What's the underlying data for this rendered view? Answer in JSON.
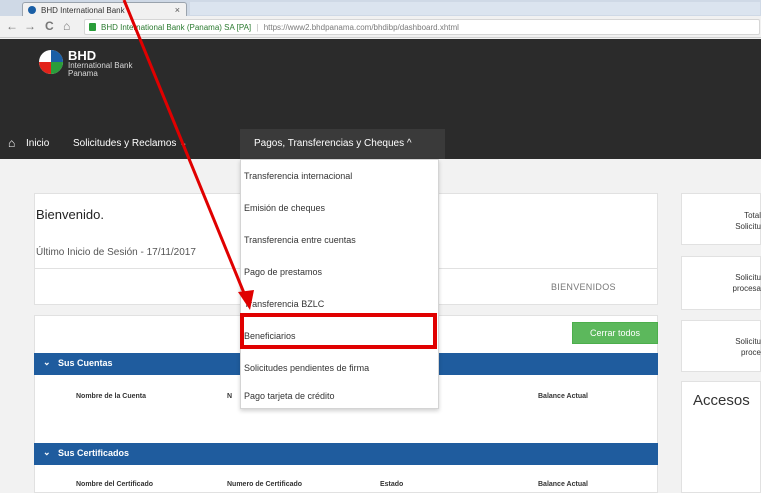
{
  "browser": {
    "tab_title": "BHD International Bank",
    "tab_close": "×",
    "url_secure_text": "BHD International Bank (Panama) SA [PA]",
    "url": "https://www2.bhdpanama.com/bhdibp/dashboard.xhtml",
    "back_glyph": "←",
    "forward_glyph": "→",
    "reload_glyph": "C",
    "home_glyph": "⌂"
  },
  "brand": {
    "name": "BHD",
    "line1": "International Bank",
    "line2": "Panama"
  },
  "nav": {
    "home_glyph": "⌂",
    "home_label": "Inicio",
    "requests_label": "Solicitudes y Reclamos",
    "requests_caret": "⌄",
    "payments_label": "Pagos, Transferencias y Cheques",
    "payments_caret": "^"
  },
  "dropdown": {
    "items": [
      "Transferencia internacional",
      "Emisión de cheques",
      "Transferencia entre cuentas",
      "Pago de prestamos",
      "Transferencia BZLC",
      "Beneficiarios",
      "Solicitudes pendientes de firma",
      "Pago tarjeta de crédito"
    ],
    "highlighted_index": 5
  },
  "welcome": {
    "title": "Bienvenido.",
    "last_login": "Último Inicio de Sesión - 17/11/2017",
    "banner": "BIENVENIDOS"
  },
  "actions": {
    "close_all": "Cerrar todos"
  },
  "accounts_panel": {
    "title": "Sus Cuentas",
    "chevron": "⌄",
    "columns": [
      "Nombre de la Cuenta",
      "N",
      "Balance Actual"
    ]
  },
  "certificates_panel": {
    "title": "Sus Certificados",
    "chevron": "⌄",
    "columns": [
      "Nombre del Certificado",
      "Numero de Certificado",
      "Estado",
      "Balance Actual"
    ]
  },
  "side": {
    "card1_line1": "Total",
    "card1_line2": "Solicitu",
    "card2_line1": "Solicitu",
    "card2_line2": "procesa",
    "card3_line1": "Solicitu",
    "card3_line2": "proce",
    "accesos": "Accesos"
  },
  "colors": {
    "header_bg": "#2b2b2b",
    "panel_blue": "#1f5c9e",
    "success_green": "#5cb85c",
    "annotation_red": "#e00000"
  }
}
